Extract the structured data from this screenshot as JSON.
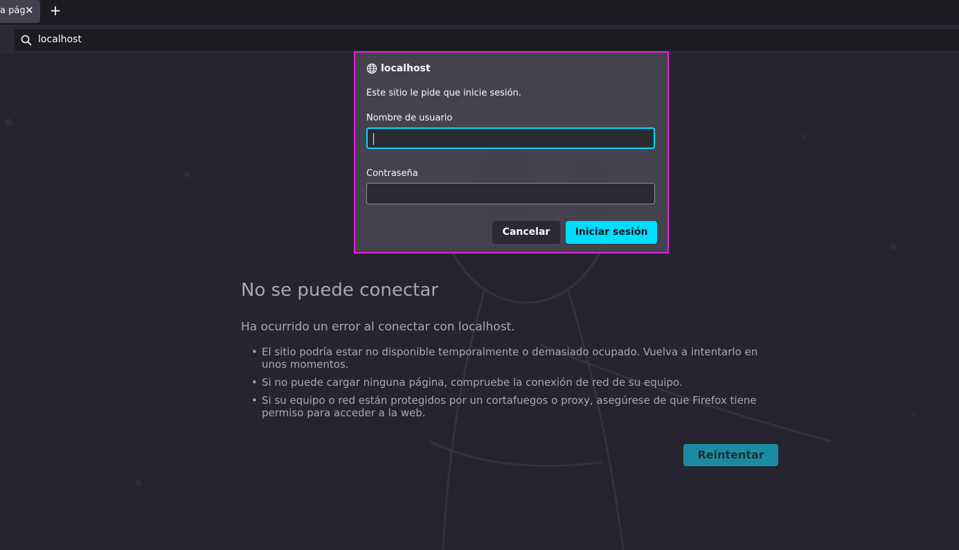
{
  "tabs": [
    {
      "label": "a pág",
      "close_icon": "close-icon"
    }
  ],
  "new_tab_symbol": "+",
  "urlbar": {
    "value": "localhost",
    "icon": "search-icon"
  },
  "error_page": {
    "title": "No se puede conectar",
    "description": "Ha ocurrido un error al conectar con localhost.",
    "bullets": [
      "El sitio podría estar no disponible temporalmente o demasiado ocupado. Vuelva a intentarlo en unos momentos.",
      "Si no puede cargar ninguna página, compruebe la conexión de red de su equipo.",
      "Si su equipo o red están protegidos por un cortafuegos o proxy, asegúrese de que Firefox tiene permiso para acceder a la web."
    ],
    "retry_label": "Reintentar"
  },
  "auth_dialog": {
    "host": "localhost",
    "host_icon": "globe-icon",
    "message": "Este sitio le pide que inicie sesión.",
    "username_label": "Nombre de usuario",
    "username_value": "",
    "password_label": "Contraseña",
    "password_value": "",
    "cancel_label": "Cancelar",
    "login_label": "Iniciar sesión",
    "highlight_color": "#e61ee6",
    "accent_color": "#00ddff"
  }
}
